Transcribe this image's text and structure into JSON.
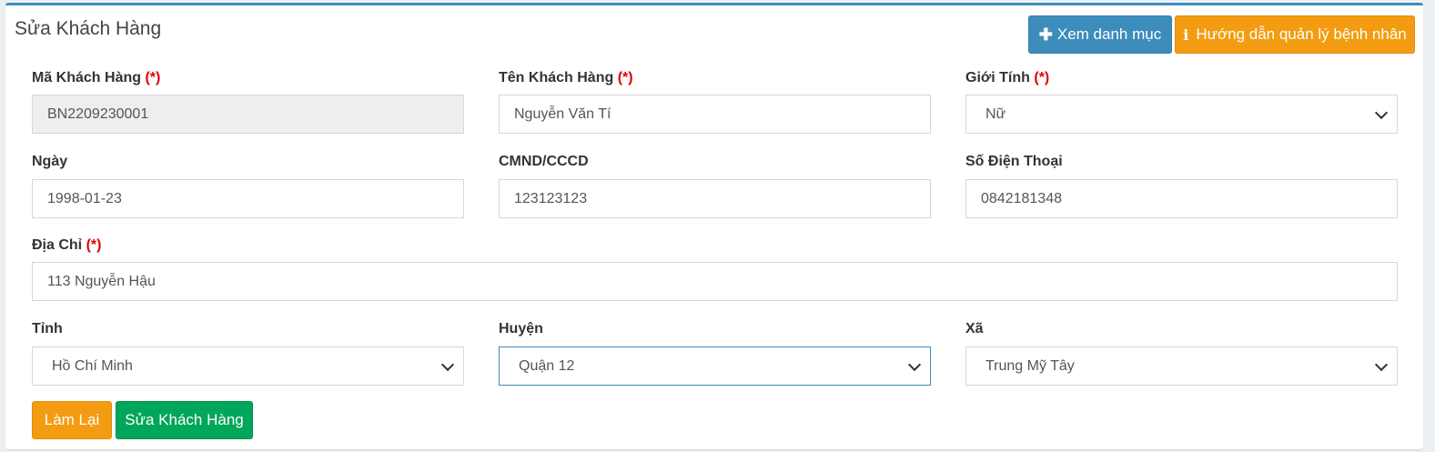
{
  "page": {
    "title": "Sửa Khách Hàng"
  },
  "header_buttons": {
    "view_list": {
      "icon": "plus-icon",
      "label": "Xem danh mục"
    },
    "guide": {
      "icon": "info-icon",
      "label": "Hướng dẫn quản lý bệnh nhân"
    }
  },
  "required_mark": "(*)",
  "fields": {
    "customer_code": {
      "label": "Mã Khách Hàng",
      "value": "BN2209230001",
      "required": true,
      "readonly": true
    },
    "customer_name": {
      "label": "Tên Khách Hàng",
      "value": "Nguyễn Văn Tí",
      "required": true
    },
    "gender": {
      "label": "Giới Tính",
      "value": "Nữ",
      "required": true
    },
    "date": {
      "label": "Ngày",
      "value": "1998-01-23"
    },
    "id_card": {
      "label": "CMND/CCCD",
      "value": "123123123"
    },
    "phone": {
      "label": "Số Điện Thoại",
      "value": "0842181348"
    },
    "address": {
      "label": "Địa Chỉ",
      "value": "113 Nguyễn Hậu",
      "required": true
    },
    "province": {
      "label": "Tỉnh",
      "value": "Hồ Chí Minh"
    },
    "district": {
      "label": "Huyện",
      "value": "Quận 12"
    },
    "ward": {
      "label": "Xã",
      "value": "Trung Mỹ Tây"
    }
  },
  "actions": {
    "reset": "Làm Lại",
    "submit": "Sửa Khách Hàng"
  },
  "colors": {
    "primary": "#3c8dbc",
    "warning": "#f39c12",
    "success": "#00a65a",
    "required": "#dd0000"
  }
}
